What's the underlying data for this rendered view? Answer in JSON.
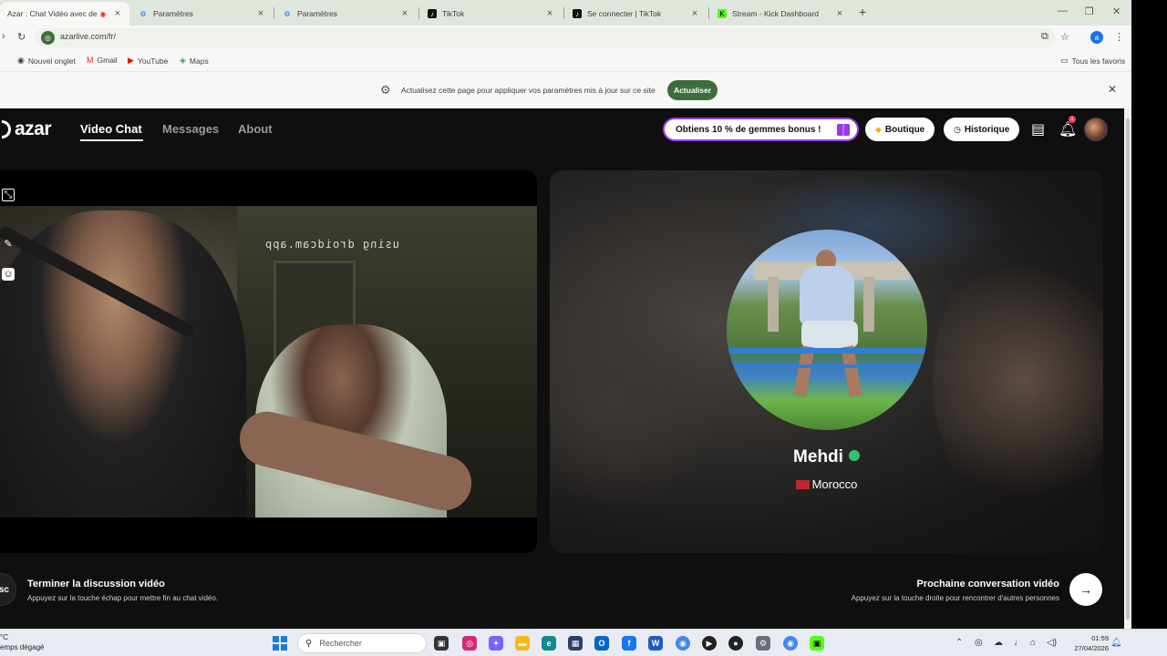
{
  "browser": {
    "tabs": [
      {
        "title": "Azar : Chat Vidéo avec de n",
        "active": true
      },
      {
        "title": "Paramètres"
      },
      {
        "title": "Paramètres"
      },
      {
        "title": "TikTok"
      },
      {
        "title": "Se connecter | TikTok"
      },
      {
        "title": "Stream - Kick Dashboard"
      }
    ],
    "url": "azarlive.com/fr/",
    "profile_initial": "a",
    "bookmarks": [
      "Nouvel onglet",
      "Gmail",
      "YouTube",
      "Maps"
    ],
    "all_bookmarks": "Tous les favoris",
    "infobar": {
      "text": "Actualisez cette page pour appliquer vos paramètres mis à jour sur ce site",
      "button": "Actualiser"
    }
  },
  "app": {
    "logo": "azar",
    "nav": [
      "Video Chat",
      "Messages",
      "About"
    ],
    "promo": "Obtiens 10 % de gemmes bonus !",
    "shop_button": "Boutique",
    "history_button": "Historique",
    "notification_count": "1",
    "local_video_watermark": "using droidcam.app",
    "match": {
      "name": "Mehdi",
      "country": "Morocco"
    },
    "controls": {
      "esc_key": "sc",
      "end_title": "Terminer la discussion vidéo",
      "end_subtitle": "Appuyez sur la touche échap pour mettre fin au chat vidéo.",
      "next_title": "Prochaine conversation vidéo",
      "next_subtitle": "Appuyez sur la touche droite pour rencontrer d'autres personnes",
      "next_icon": "→"
    }
  },
  "taskbar": {
    "weather_temp": "°C",
    "weather_desc": "emps dégagé",
    "search_placeholder": "Rechercher",
    "time": "01:59",
    "date": "27/04/2026"
  },
  "colors": {
    "accent_green": "#3c6e3a",
    "promo_border": "#9b3cf0",
    "verified": "#2ec46b"
  }
}
